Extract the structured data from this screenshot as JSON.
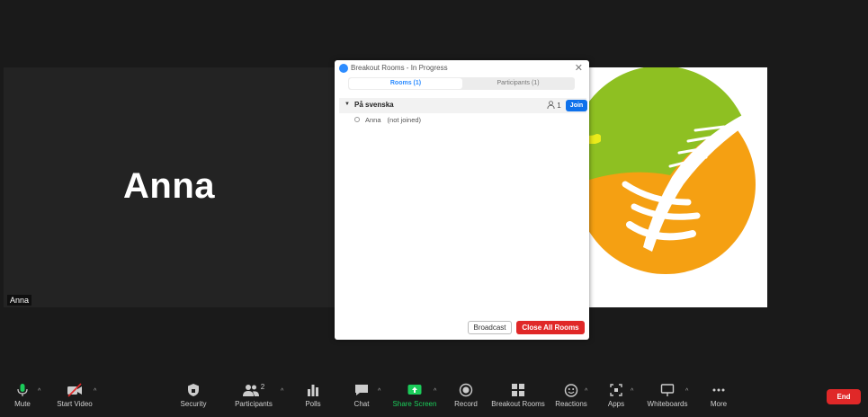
{
  "participant_tile": {
    "big_name": "Anna",
    "name_label": "Anna"
  },
  "dialog": {
    "title": "Breakout Rooms - In Progress",
    "tabs": [
      "Rooms (1)",
      "Participants (1)"
    ],
    "rooms": [
      {
        "name": "På svenska",
        "count": "1",
        "join_label": "Join",
        "members": [
          {
            "name": "Anna",
            "status": "(not joined)"
          }
        ]
      }
    ],
    "broadcast_label": "Broadcast",
    "close_all_label": "Close All Rooms"
  },
  "toolbar": {
    "mute": "Mute",
    "start_video": "Start Video",
    "security": "Security",
    "participants": "Participants",
    "participants_count": "2",
    "polls": "Polls",
    "chat": "Chat",
    "share_screen": "Share Screen",
    "record": "Record",
    "breakout_rooms": "Breakout Rooms",
    "reactions": "Reactions",
    "apps": "Apps",
    "whiteboards": "Whiteboards",
    "more": "More",
    "end": "End"
  },
  "colors": {
    "accent": "#0e71eb",
    "danger": "#e02828",
    "share_green": "#1bcc5a",
    "highlight": "#f2ef1b"
  }
}
